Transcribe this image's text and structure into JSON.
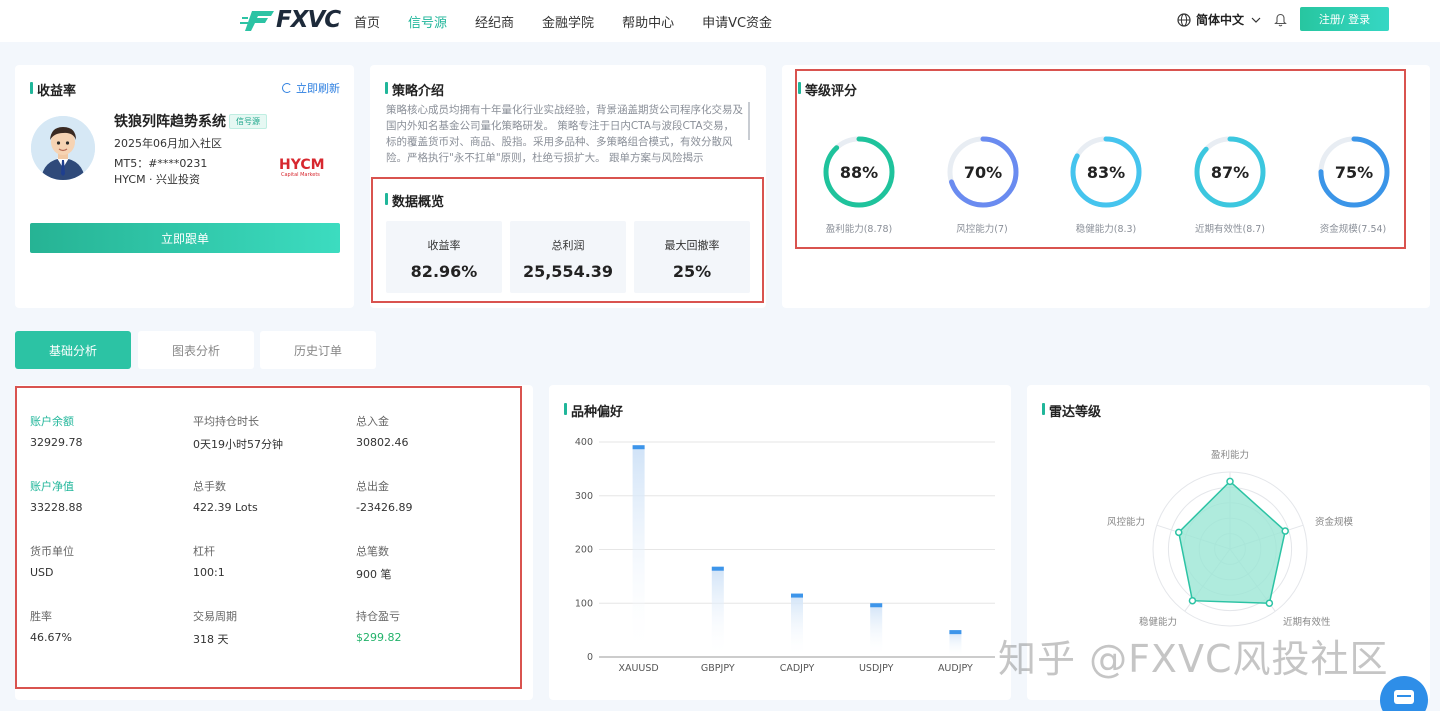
{
  "header": {
    "logo_text": "FXVC",
    "nav": [
      "首页",
      "信号源",
      "经纪商",
      "金融学院",
      "帮助中心",
      "申请VC资金"
    ],
    "active_nav": "信号源",
    "language": "简体中文",
    "login_label": "注册/ 登录"
  },
  "profile": {
    "title": "收益率",
    "refresh_label": "立即刷新",
    "name": "铁狼列阵趋势系统",
    "badge": "信号源",
    "joined": "2025年06月加入社区",
    "account": "MT5：#****0231",
    "broker": "HYCM · 兴业投资",
    "broker_logo": "HYCM",
    "broker_logo_sub": "Capital Markets",
    "follow_label": "立即跟单"
  },
  "strategy": {
    "title": "策略介绍",
    "text": "策略核心成员均拥有十年量化行业实战经验，背景涵盖期货公司程序化交易及国内外知名基金公司量化策略研发。 策略专注于日内CTA与波段CTA交易，标的覆盖货币对、商品、股指。采用多品种、多策略组合模式，有效分散风险。严格执行\"永不扛单\"原则，杜绝亏损扩大。 跟单方案与风险揭示"
  },
  "overview": {
    "title": "数据概览",
    "stats": [
      {
        "label": "收益率",
        "value": "82.96%"
      },
      {
        "label": "总利润",
        "value": "25,554.39"
      },
      {
        "label": "最大回撤率",
        "value": "25%"
      }
    ]
  },
  "grades": {
    "title": "等级评分",
    "items": [
      {
        "pct": "88%",
        "fraction": 0.88,
        "label": "盈利能力(8.78)",
        "color": "#1fc39c"
      },
      {
        "pct": "70%",
        "fraction": 0.7,
        "label": "风控能力(7)",
        "color": "#6a8bf0"
      },
      {
        "pct": "83%",
        "fraction": 0.83,
        "label": "稳健能力(8.3)",
        "color": "#45c4ee"
      },
      {
        "pct": "87%",
        "fraction": 0.87,
        "label": "近期有效性(8.7)",
        "color": "#3cc7df"
      },
      {
        "pct": "75%",
        "fraction": 0.75,
        "label": "资金规模(7.54)",
        "color": "#3b95e8"
      }
    ]
  },
  "tabs": [
    "基础分析",
    "图表分析",
    "历史订单"
  ],
  "basic": {
    "cells": [
      {
        "label": "账户余额",
        "value": "32929.78",
        "label_green": true
      },
      {
        "label": "平均持仓时长",
        "value": "0天19小时57分钟"
      },
      {
        "label": "总入金",
        "value": "30802.46"
      },
      {
        "label": "账户净值",
        "value": "33228.88",
        "label_green": true
      },
      {
        "label": "总手数",
        "value": "422.39 Lots"
      },
      {
        "label": "总出金",
        "value": "-23426.89"
      },
      {
        "label": "货币单位",
        "value": "USD"
      },
      {
        "label": "杠杆",
        "value": "100:1"
      },
      {
        "label": "总笔数",
        "value": "900 笔"
      },
      {
        "label": "胜率",
        "value": "46.67%"
      },
      {
        "label": "交易周期",
        "value": "318 天"
      },
      {
        "label": "持仓盈亏",
        "value": "$299.82",
        "value_green": true
      }
    ]
  },
  "chart_data": {
    "type": "bar",
    "title": "品种偏好",
    "categories": [
      "XAUUSD",
      "GBPJPY",
      "CADJPY",
      "USDJPY",
      "AUDJPY"
    ],
    "values": [
      394,
      168,
      118,
      100,
      50
    ],
    "yticks": [
      "0",
      "100",
      "200",
      "300",
      "400"
    ],
    "ylim": [
      0,
      400
    ],
    "grid": true,
    "bar_color": "#3d95ea"
  },
  "radar": {
    "title": "雷达等级",
    "axes": [
      "盈利能力",
      "资金规模",
      "近期有效性",
      "稳健能力",
      "风控能力"
    ],
    "values": [
      0.878,
      0.754,
      0.87,
      0.83,
      0.7
    ],
    "fill": "#9be6d5",
    "stroke": "#2cc3a4"
  },
  "watermark": "知乎 @FXVC风投社区"
}
